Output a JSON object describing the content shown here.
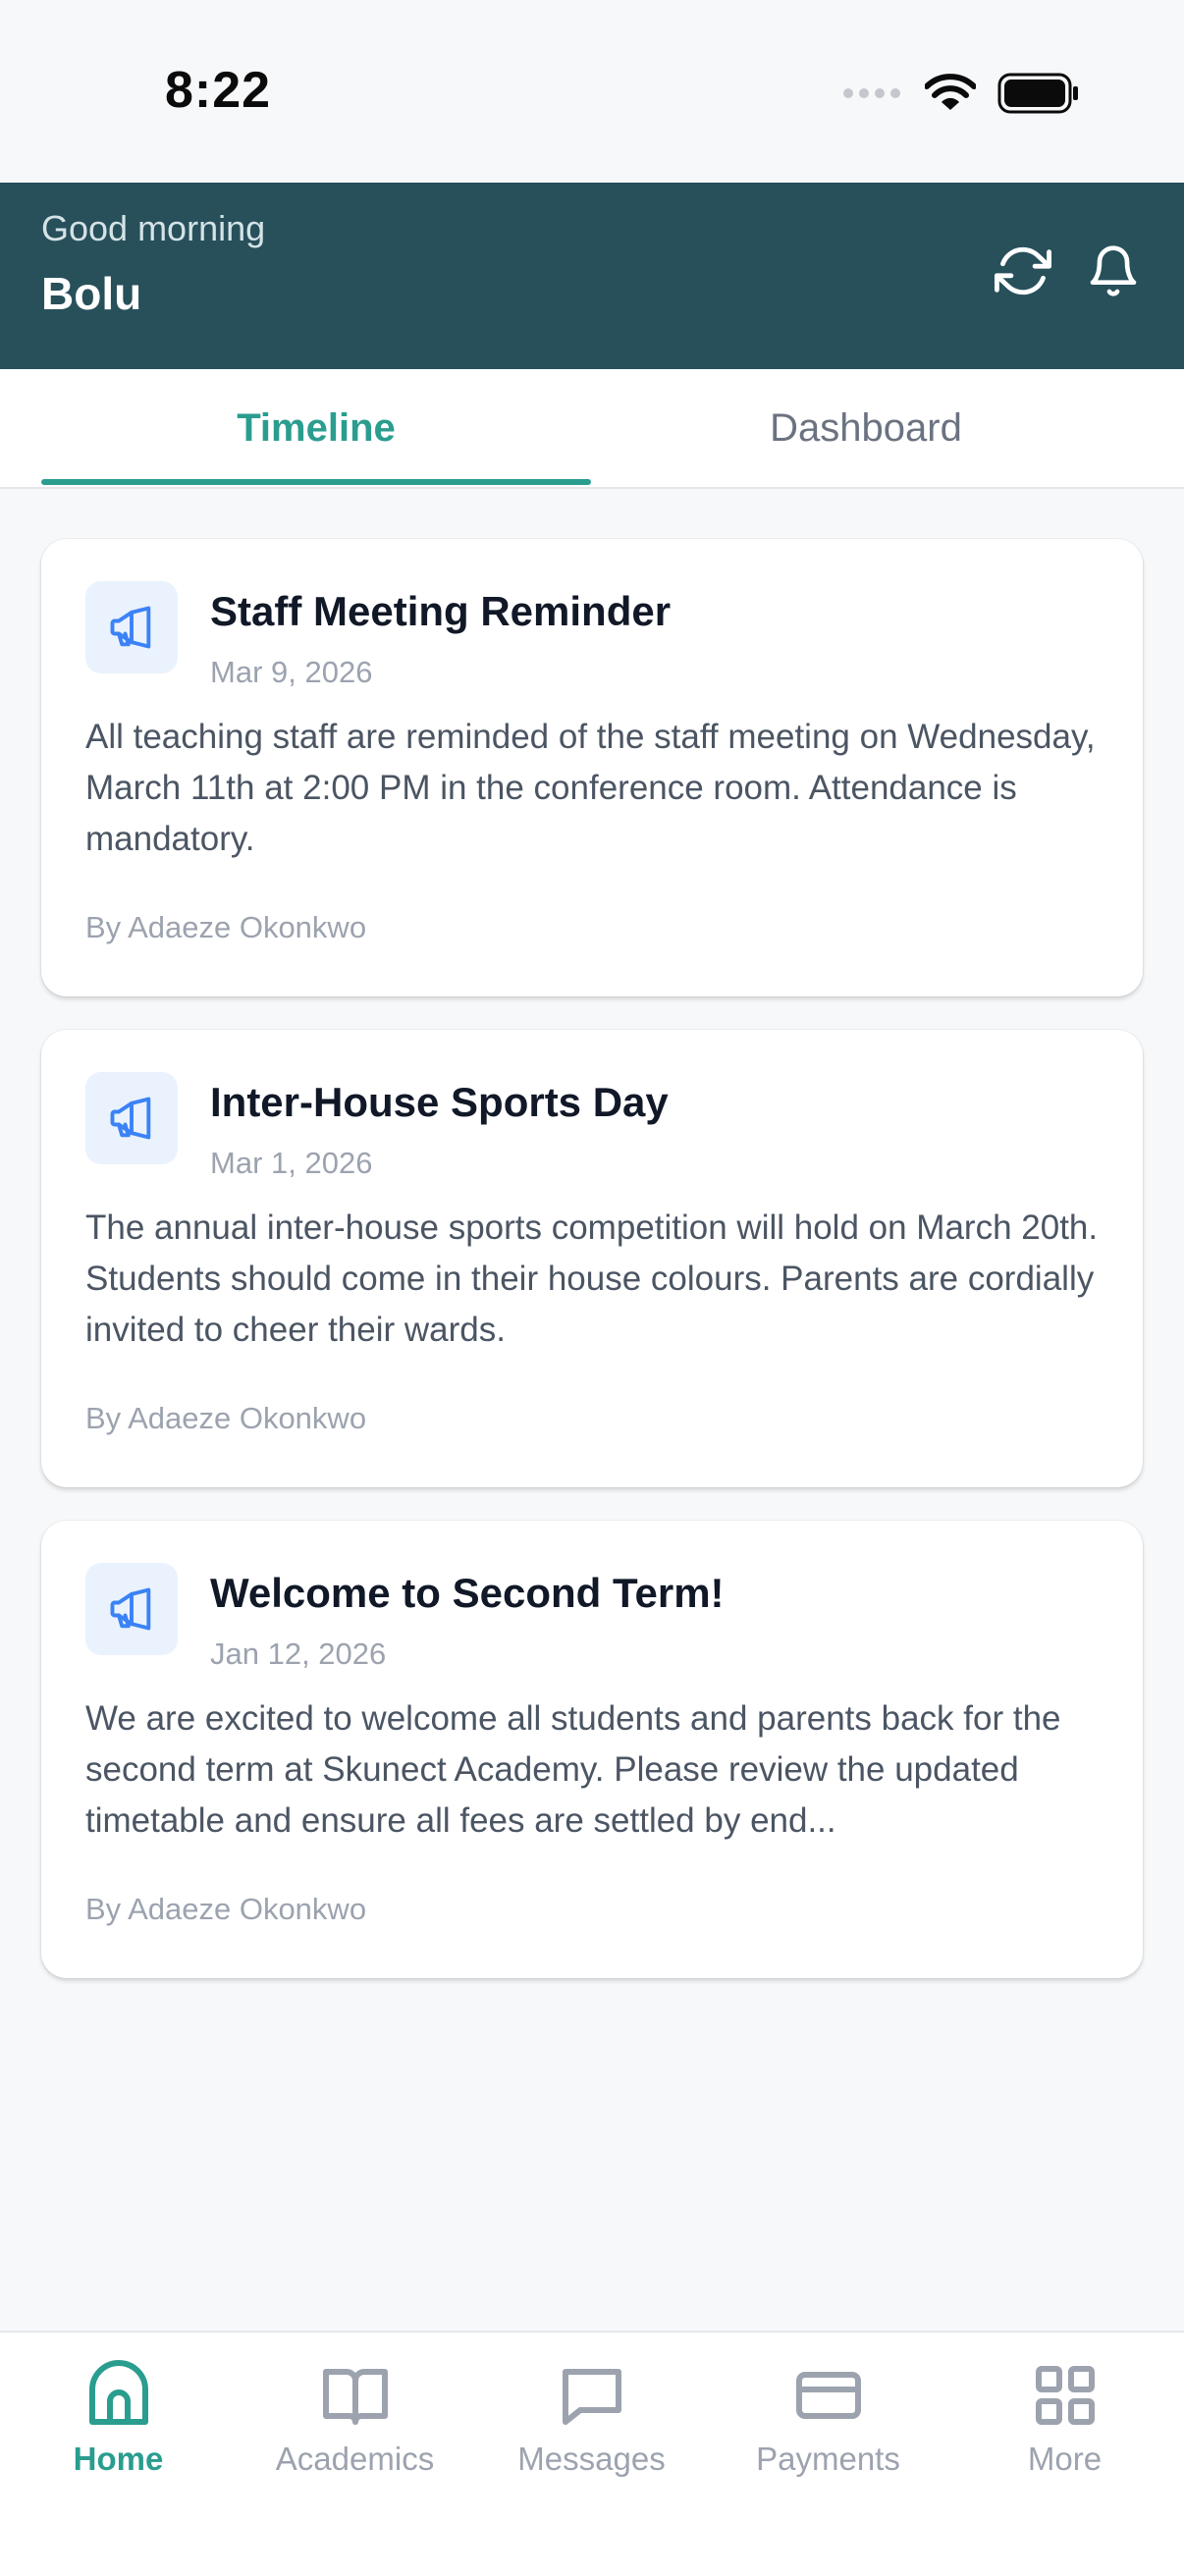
{
  "status_bar": {
    "time": "8:22"
  },
  "header": {
    "greeting": "Good morning",
    "user_name": "Bolu"
  },
  "tabs": [
    {
      "label": "Timeline",
      "active": true
    },
    {
      "label": "Dashboard",
      "active": false
    }
  ],
  "announcements": [
    {
      "title": "Staff Meeting Reminder",
      "date": "Mar 9, 2026",
      "body": "All teaching staff are reminded of the staff meeting on Wednesday, March 11th at 2:00 PM in the conference room. Attendance is mandatory.",
      "author": "By Adaeze Okonkwo",
      "icon": "megaphone-icon"
    },
    {
      "title": "Inter-House Sports Day",
      "date": "Mar 1, 2026",
      "body": "The annual inter-house sports competition will hold on March 20th. Students should come in their house colours. Parents are cordially invited to cheer their wards.",
      "author": "By Adaeze Okonkwo",
      "icon": "megaphone-icon"
    },
    {
      "title": "Welcome to Second Term!",
      "date": "Jan 12, 2026",
      "body": "We are excited to welcome all students and parents back for the second term at Skunect Academy. Please review the updated timetable and ensure all fees are settled by end...",
      "author": "By Adaeze Okonkwo",
      "icon": "megaphone-icon"
    }
  ],
  "bottom_nav": [
    {
      "label": "Home",
      "icon": "home-icon",
      "active": true
    },
    {
      "label": "Academics",
      "icon": "book-icon",
      "active": false
    },
    {
      "label": "Messages",
      "icon": "message-icon",
      "active": false
    },
    {
      "label": "Payments",
      "icon": "card-icon",
      "active": false
    },
    {
      "label": "More",
      "icon": "grid-icon",
      "active": false
    }
  ],
  "colors": {
    "header_bg": "#27505b",
    "accent": "#2a9d8f",
    "icon_blue": "#3b82f6",
    "inactive": "#9ca3af"
  }
}
